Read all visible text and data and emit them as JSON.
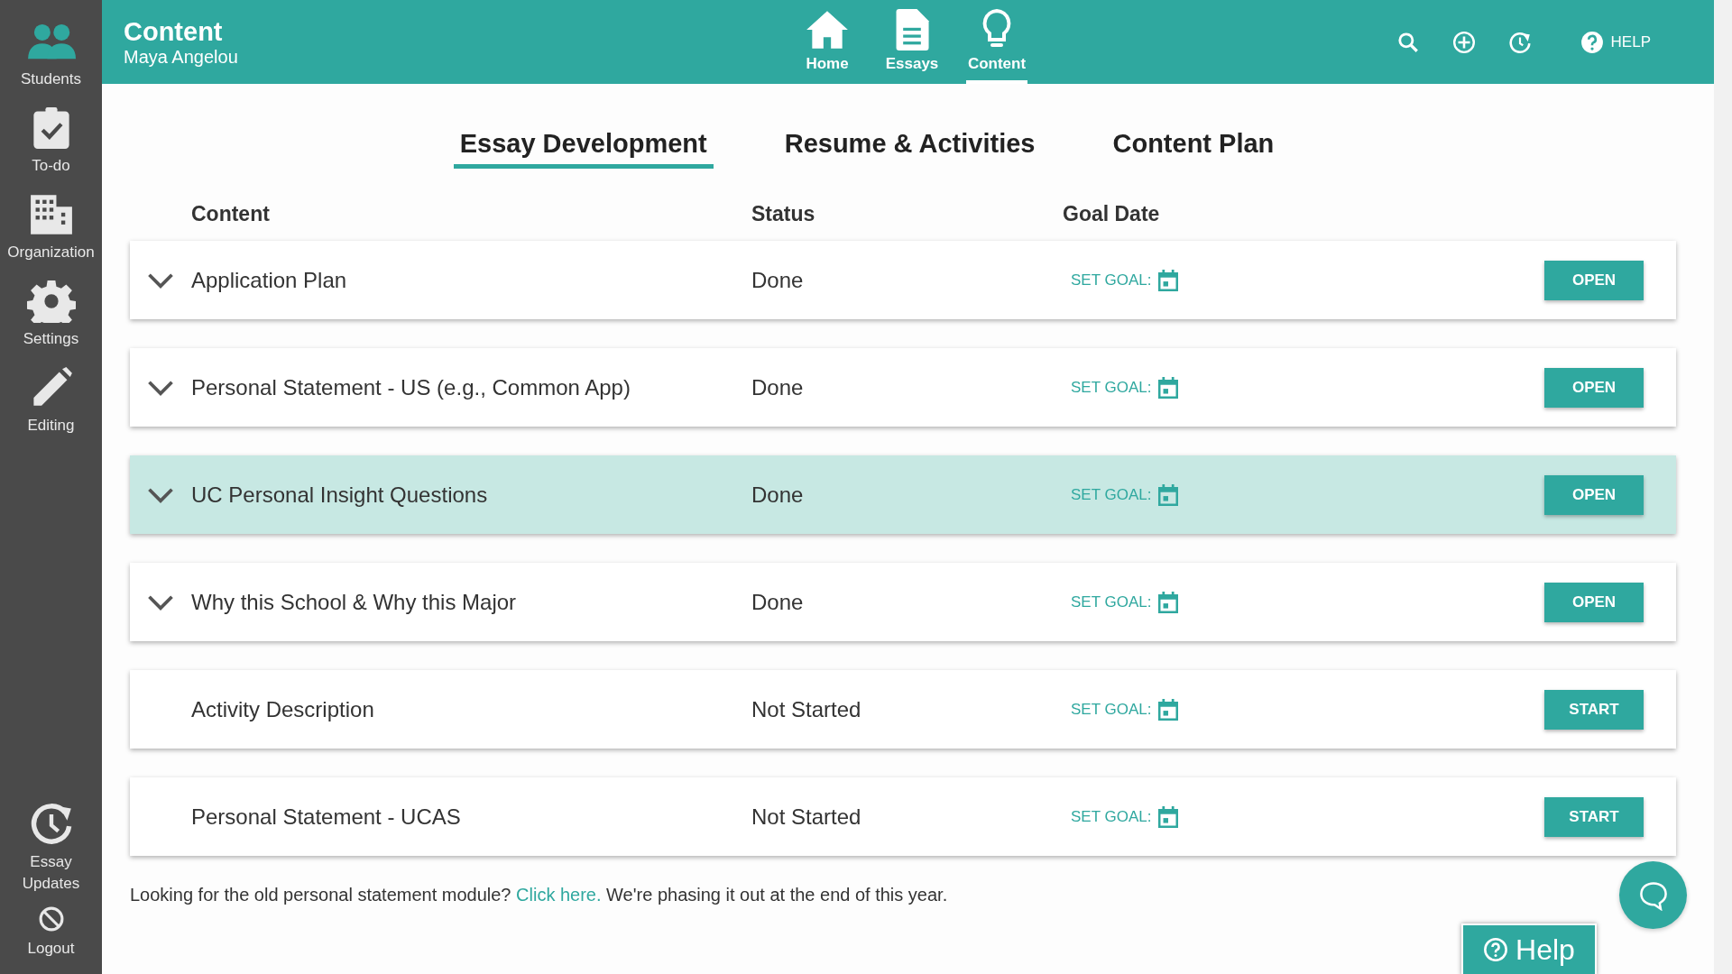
{
  "sidebar": {
    "items": [
      {
        "kind": "students",
        "label": "Students",
        "selected": true
      },
      {
        "kind": "todo",
        "label": "To-do",
        "selected": false
      },
      {
        "kind": "organization",
        "label": "Organization",
        "selected": false
      },
      {
        "kind": "settings",
        "label": "Settings",
        "selected": false
      },
      {
        "kind": "editing",
        "label": "Editing",
        "selected": false
      }
    ],
    "bottom_items": [
      {
        "kind": "updates",
        "label": "Essay Updates"
      },
      {
        "kind": "logout",
        "label": "Logout"
      }
    ]
  },
  "header": {
    "title": "Content",
    "subtitle": "Maya Angelou",
    "nav": [
      {
        "kind": "home",
        "label": "Home",
        "selected": false
      },
      {
        "kind": "essays",
        "label": "Essays",
        "selected": false
      },
      {
        "kind": "content",
        "label": "Content",
        "selected": true
      }
    ],
    "help_label": "HELP"
  },
  "tabs": [
    {
      "label": "Essay Development",
      "selected": true
    },
    {
      "label": "Resume & Activities",
      "selected": false
    },
    {
      "label": "Content Plan",
      "selected": false
    }
  ],
  "table": {
    "columns": [
      "Content",
      "Status",
      "Goal Date"
    ],
    "rows": [
      {
        "name": "Application Plan",
        "status": "Done",
        "goal_label": "SET GOAL:",
        "action": "OPEN",
        "expandable": true,
        "highlighted": false
      },
      {
        "name": "Personal Statement - US (e.g., Common App)",
        "status": "Done",
        "goal_label": "SET GOAL:",
        "action": "OPEN",
        "expandable": true,
        "highlighted": false
      },
      {
        "name": "UC Personal Insight Questions",
        "status": "Done",
        "goal_label": "SET GOAL:",
        "action": "OPEN",
        "expandable": true,
        "highlighted": true
      },
      {
        "name": "Why this School & Why this Major",
        "status": "Done",
        "goal_label": "SET GOAL:",
        "action": "OPEN",
        "expandable": true,
        "highlighted": false
      },
      {
        "name": "Activity Description",
        "status": "Not Started",
        "goal_label": "SET GOAL:",
        "action": "START",
        "expandable": false,
        "highlighted": false
      },
      {
        "name": "Personal Statement - UCAS",
        "status": "Not Started",
        "goal_label": "SET GOAL:",
        "action": "START",
        "expandable": false,
        "highlighted": false
      }
    ]
  },
  "footer": {
    "before": "Looking for the old personal statement module?",
    "link": "Click here.",
    "after": "We're phasing it out at the end of this year."
  },
  "help_button": {
    "label": "Help"
  }
}
